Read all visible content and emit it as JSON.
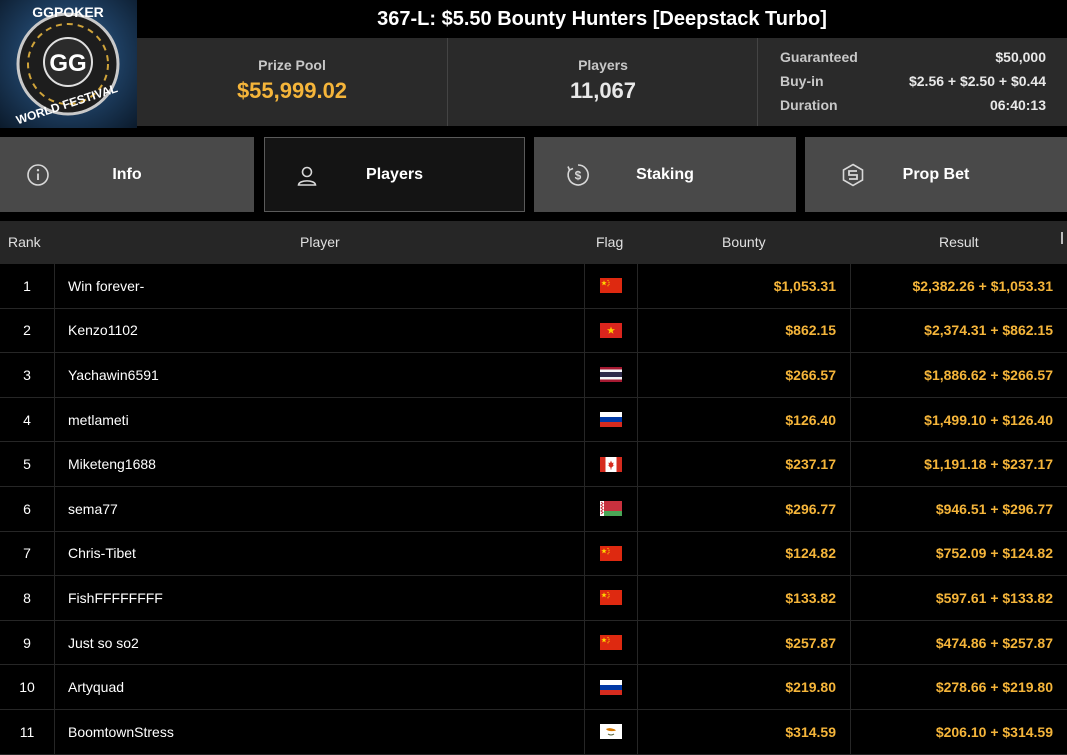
{
  "header": {
    "logo_top": "GGPOKER",
    "logo_bottom": "WORLD FESTIVAL",
    "logo_mark": "GG",
    "title": "367-L: $5.50 Bounty Hunters [Deepstack Turbo]"
  },
  "stats": {
    "prize_pool_label": "Prize Pool",
    "prize_pool_value": "$55,999.02",
    "players_label": "Players",
    "players_value": "11,067",
    "details": [
      {
        "label": "Guaranteed",
        "value": "$50,000"
      },
      {
        "label": "Buy-in",
        "value": "$2.56 + $2.50 + $0.44"
      },
      {
        "label": "Duration",
        "value": "06:40:13"
      }
    ]
  },
  "tabs": [
    {
      "label": "Info",
      "icon": "info-icon",
      "active": false
    },
    {
      "label": "Players",
      "icon": "user-icon",
      "active": true
    },
    {
      "label": "Staking",
      "icon": "staking-dollar-icon",
      "active": false
    },
    {
      "label": "Prop Bet",
      "icon": "prop-bet-icon",
      "active": false
    }
  ],
  "table": {
    "columns": [
      "Rank",
      "Player",
      "Flag",
      "Bounty",
      "Result"
    ],
    "rows": [
      {
        "rank": "1",
        "player": "Win forever-",
        "flag": "china-flag",
        "bounty": "$1,053.31",
        "result": "$2,382.26 + $1,053.31"
      },
      {
        "rank": "2",
        "player": "Kenzo1102",
        "flag": "vietnam-flag",
        "bounty": "$862.15",
        "result": "$2,374.31 + $862.15"
      },
      {
        "rank": "3",
        "player": "Yachawin6591",
        "flag": "thailand-flag",
        "bounty": "$266.57",
        "result": "$1,886.62 + $266.57"
      },
      {
        "rank": "4",
        "player": "metlameti",
        "flag": "russia-flag",
        "bounty": "$126.40",
        "result": "$1,499.10 + $126.40"
      },
      {
        "rank": "5",
        "player": "Miketeng1688",
        "flag": "canada-flag",
        "bounty": "$237.17",
        "result": "$1,191.18 + $237.17"
      },
      {
        "rank": "6",
        "player": "sema77",
        "flag": "belarus-flag",
        "bounty": "$296.77",
        "result": "$946.51 + $296.77"
      },
      {
        "rank": "7",
        "player": "Chris-Tibet",
        "flag": "china-flag",
        "bounty": "$124.82",
        "result": "$752.09 + $124.82"
      },
      {
        "rank": "8",
        "player": "FishFFFFFFFF",
        "flag": "china-flag",
        "bounty": "$133.82",
        "result": "$597.61 + $133.82"
      },
      {
        "rank": "9",
        "player": "Just so so2",
        "flag": "china-flag",
        "bounty": "$257.87",
        "result": "$474.86 + $257.87"
      },
      {
        "rank": "10",
        "player": "Artyquad",
        "flag": "russia-flag",
        "bounty": "$219.80",
        "result": "$278.66 + $219.80"
      },
      {
        "rank": "11",
        "player": "BoomtownStress",
        "flag": "cyprus-flag",
        "bounty": "$314.59",
        "result": "$206.10 + $314.59"
      }
    ]
  },
  "colors": {
    "accent_gold": "#f5b53a",
    "panel": "#2a2a2a",
    "tab": "#494949"
  }
}
